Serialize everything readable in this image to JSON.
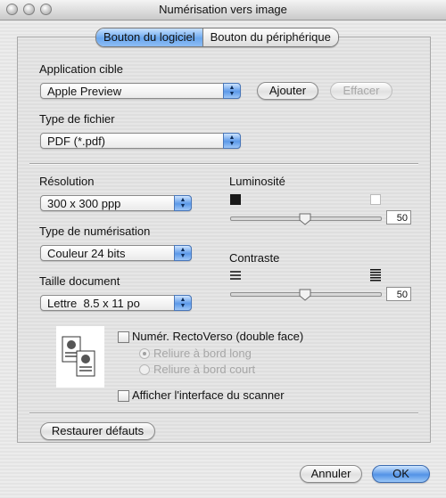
{
  "window": {
    "title": "Numérisation vers image"
  },
  "tabs": [
    {
      "label": "Bouton du logiciel",
      "selected": true
    },
    {
      "label": "Bouton du périphérique",
      "selected": false
    }
  ],
  "application": {
    "label": "Application cible",
    "value": "Apple Preview",
    "add_label": "Ajouter",
    "delete_label": "Effacer"
  },
  "filetype": {
    "label": "Type de fichier",
    "value": "PDF (*.pdf)"
  },
  "resolution": {
    "label": "Résolution",
    "value": "300 x 300 ppp"
  },
  "scan_type": {
    "label": "Type de numérisation",
    "value": "Couleur 24 bits"
  },
  "doc_size": {
    "label": "Taille document",
    "value": "Lettre  8.5 x 11 po"
  },
  "brightness": {
    "label": "Luminosité",
    "value": "50",
    "level": 50
  },
  "contrast": {
    "label": "Contraste",
    "value": "50",
    "level": 50
  },
  "duplex": {
    "label": "Numér. RectoVerso (double face)",
    "checked": false,
    "long_edge": "Reliure à bord long",
    "short_edge": "Reliure à bord court"
  },
  "show_scanner_ui": {
    "label": "Afficher l'interface du scanner",
    "checked": false
  },
  "footer": {
    "restore_label": "Restaurer défauts",
    "cancel_label": "Annuler",
    "ok_label": "OK"
  },
  "colors": {
    "accent": "#5c99e8",
    "disabled_text": "#a6a6a6"
  },
  "icons": [
    "close-icon",
    "minimize-icon",
    "zoom-icon",
    "popup-arrows-icon",
    "slider-thumb-icon",
    "duplex-document-icon",
    "brightness-dark-icon",
    "brightness-light-icon",
    "contrast-low-icon",
    "contrast-high-icon"
  ]
}
